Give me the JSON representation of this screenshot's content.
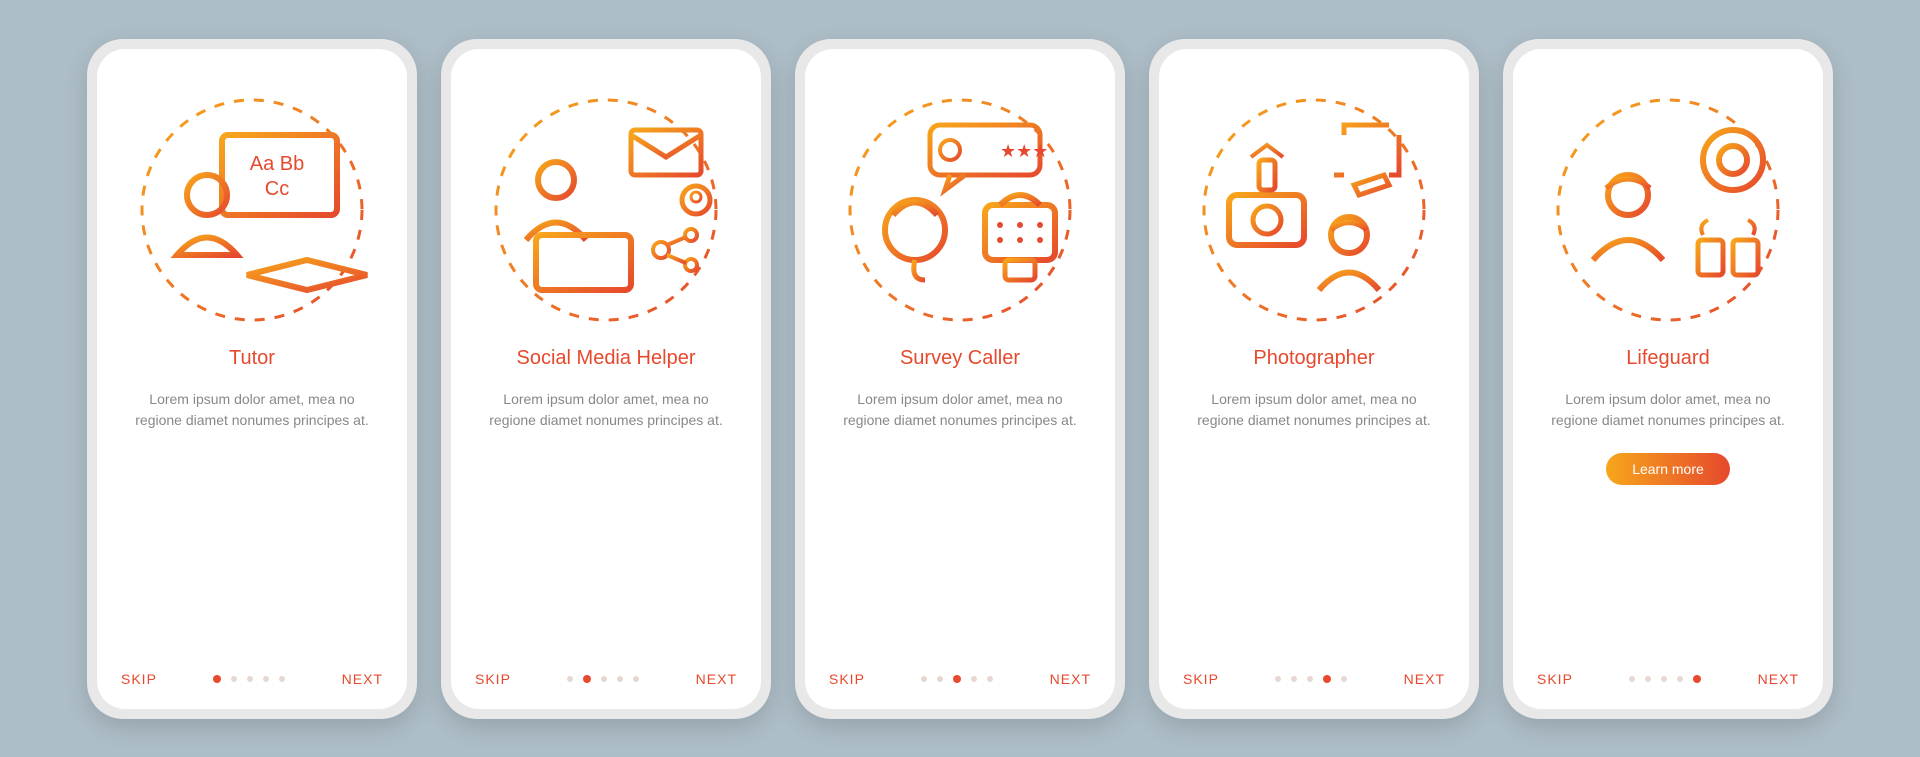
{
  "colors": {
    "accent": "#e6492d",
    "gradient_start": "#f7a61b",
    "gradient_end": "#e6492d",
    "text_muted": "#888888",
    "bg": "#aebec8"
  },
  "common": {
    "skip": "SKIP",
    "next": "NEXT",
    "desc": "Lorem ipsum dolor amet, mea no regione diamet nonumes principes at.",
    "learn_more": "Learn more"
  },
  "screens": [
    {
      "title": "Tutor",
      "icon": "tutor-icon",
      "active_dot": 0,
      "has_cta": false
    },
    {
      "title": "Social Media Helper",
      "icon": "social-media-icon",
      "active_dot": 1,
      "has_cta": false
    },
    {
      "title": "Survey Caller",
      "icon": "survey-caller-icon",
      "active_dot": 2,
      "has_cta": false
    },
    {
      "title": "Photographer",
      "icon": "photographer-icon",
      "active_dot": 3,
      "has_cta": false
    },
    {
      "title": "Lifeguard",
      "icon": "lifeguard-icon",
      "active_dot": 4,
      "has_cta": true
    }
  ]
}
